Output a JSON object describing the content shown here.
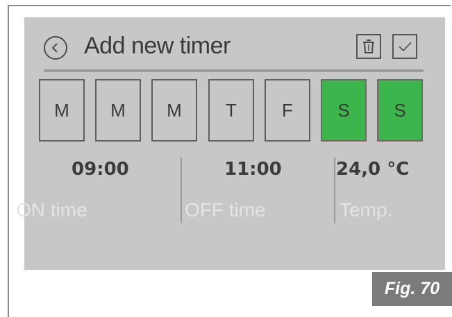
{
  "header": {
    "title": "Add new timer"
  },
  "icons": {
    "back": "chevron-left-icon",
    "delete": "trash-icon",
    "confirm": "check-icon"
  },
  "days": [
    {
      "label": "M",
      "active": false
    },
    {
      "label": "M",
      "active": false
    },
    {
      "label": "M",
      "active": false
    },
    {
      "label": "T",
      "active": false
    },
    {
      "label": "F",
      "active": false
    },
    {
      "label": "S",
      "active": true
    },
    {
      "label": "S",
      "active": true
    }
  ],
  "settings": {
    "on_time": {
      "value": "09:00",
      "label": "ON time"
    },
    "off_time": {
      "value": "11:00",
      "label": "OFF time"
    },
    "temp": {
      "value": "24,0 °C",
      "label": "Temp."
    }
  },
  "colors": {
    "active_day": "#3cb54a",
    "screen_bg": "#c7c7c7"
  },
  "figure_caption": "Fig. 70"
}
